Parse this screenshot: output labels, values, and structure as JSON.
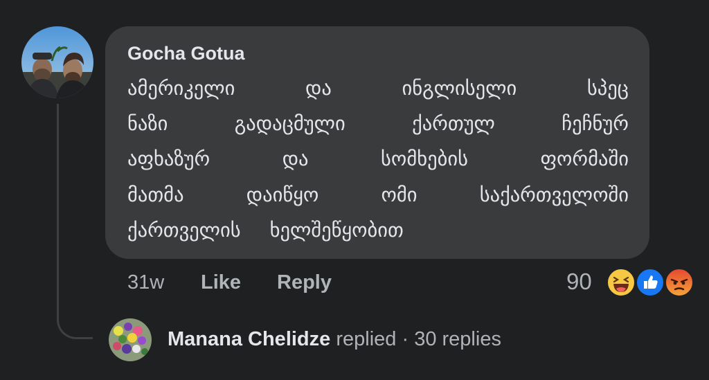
{
  "comment": {
    "author": "Gocha Gotua",
    "lines": [
      [
        "ამერიკელი",
        "და",
        "ინგლისელი",
        "სპეც"
      ],
      [
        "ნაზი",
        "გადაცმული",
        "ქართულ",
        "ჩეჩნურ"
      ],
      [
        "აფხაზურ",
        "და",
        "სომხების",
        "ფორმაში"
      ],
      [
        "მათმა",
        "დაიწყო",
        "ომი",
        "საქართველოში"
      ],
      [
        "ქართველის",
        "ხელშეწყობით"
      ]
    ],
    "time": "31w",
    "like_label": "Like",
    "reply_label": "Reply",
    "reaction_count": "90",
    "reactions": [
      "haha-icon",
      "like-icon",
      "angry-icon"
    ]
  },
  "reply_summary": {
    "name": "Manana Chelidze",
    "action": "replied",
    "separator": "·",
    "count": "30 replies"
  },
  "colors": {
    "background": "#1f2022",
    "bubble": "#3a3b3c",
    "primary_text": "#e4e6eb",
    "secondary_text": "#b0b3b8",
    "like_blue": "#1877f2",
    "haha_yellow": "#f7c844",
    "angry_orange": "#e9710f"
  }
}
